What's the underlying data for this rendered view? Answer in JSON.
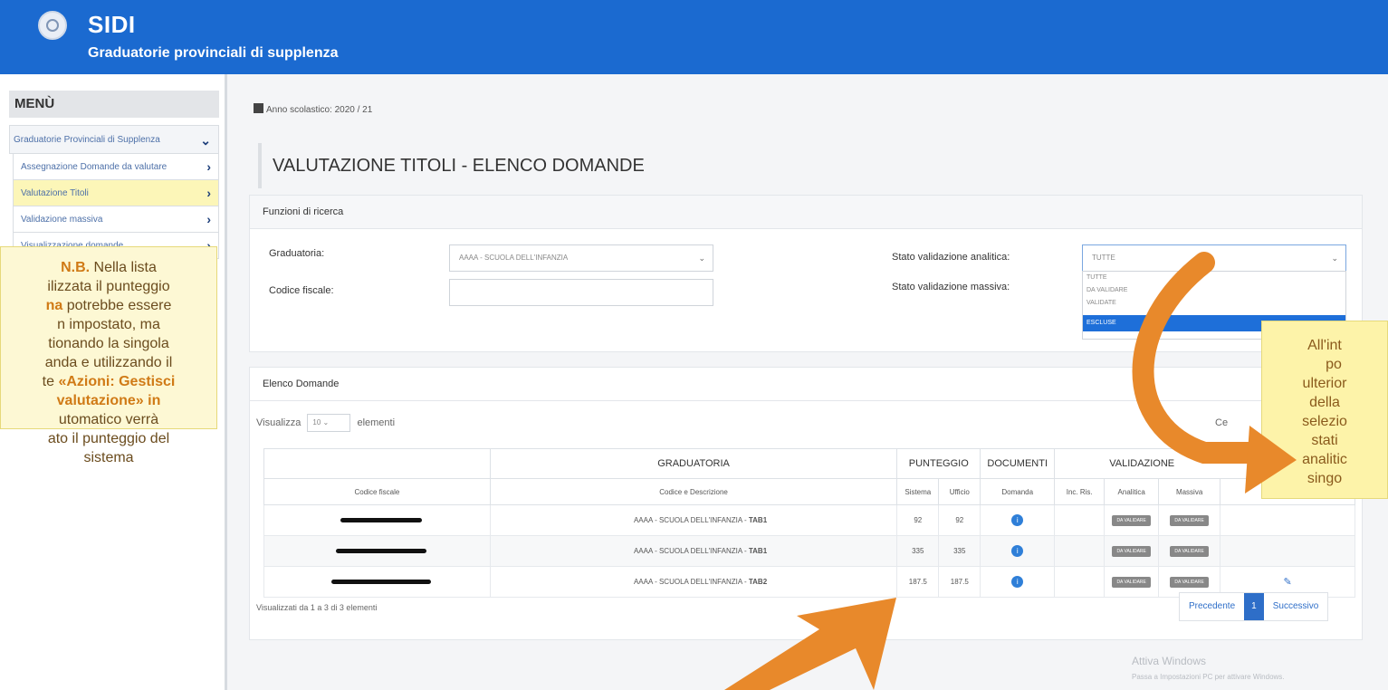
{
  "header": {
    "title": "SIDI",
    "subtitle": "Graduatorie provinciali di supplenza"
  },
  "sidebar": {
    "menu_title": "MENÙ",
    "items": [
      {
        "label": "Graduatorie Provinciali di Supplenza",
        "chevron": "v"
      },
      {
        "label": "Assegnazione Domande da valutare",
        "chevron": ">"
      },
      {
        "label": "Valutazione Titoli",
        "chevron": ">"
      },
      {
        "label": "Validazione massiva",
        "chevron": ">"
      },
      {
        "label": "Visualizzazione domande",
        "chevron": ">"
      }
    ]
  },
  "note_left": {
    "lines": [
      [
        "N.B.",
        " Nella lista"
      ],
      [
        "",
        "ilizzata il punteggio"
      ],
      [
        "na",
        " potrebbe essere"
      ],
      [
        "",
        "n impostato, ma"
      ],
      [
        "",
        "tionando la singola"
      ],
      [
        "",
        "anda e utilizzando il"
      ],
      [
        "te ",
        "«Azioni: Gestisci"
      ],
      [
        "",
        "valutazione»  in"
      ],
      [
        "",
        "utomatico verrà"
      ],
      [
        "",
        "ato il punteggio del"
      ],
      [
        "",
        "sistema"
      ]
    ]
  },
  "main": {
    "school_year": "Anno scolastico: 2020 / 21",
    "title": "VALUTAZIONE TITOLI - ELENCO DOMANDE",
    "search_panel": {
      "heading": "Funzioni di ricerca",
      "graduatoria_label": "Graduatoria:",
      "graduatoria_value": "AAAA - SCUOLA DELL'INFANZIA",
      "codice_label": "Codice fiscale:",
      "codice_value": "",
      "analitica_label": "Stato validazione analitica:",
      "analitica_value": "TUTTE",
      "massiva_label": "Stato validazione massiva:",
      "dropdown_options": [
        "TUTTE",
        "DA VALIDARE",
        "VALIDATE",
        "ESCLUSE"
      ]
    },
    "list_panel": {
      "heading": "Elenco Domande",
      "show_prefix": "Visualizza",
      "show_value": "10",
      "show_suffix": "elementi",
      "search_label": "Ce",
      "group_headers": [
        "GRADUATORIA",
        "PUNTEGGIO",
        "DOCUMENTI",
        "VALIDAZIONE"
      ],
      "columns": [
        "Codice fiscale",
        "Codice e Descrizione",
        "Sistema",
        "Ufficio",
        "Domanda",
        "Inc. Ris.",
        "Analitica",
        "Massiva"
      ],
      "rows": [
        {
          "desc": "AAAA - SCUOLA DELL'INFANZIA - ",
          "tab": "TAB1",
          "sistema": "92",
          "ufficio": "92",
          "analitica": "DA VALIDARE",
          "massiva": "DA VALIDARE"
        },
        {
          "desc": "AAAA - SCUOLA DELL'INFANZIA - ",
          "tab": "TAB1",
          "sistema": "335",
          "ufficio": "335",
          "analitica": "DA VALIDARE",
          "massiva": "DA VALIDARE"
        },
        {
          "desc": "AAAA - SCUOLA DELL'INFANZIA - ",
          "tab": "TAB2",
          "sistema": "187.5",
          "ufficio": "187.5",
          "analitica": "DA VALIDARE",
          "massiva": "DA VALIDARE"
        }
      ],
      "footer_text": "Visualizzati da 1 a 3 di 3 elementi",
      "pager": {
        "prev": "Precedente",
        "current": "1",
        "next": "Successivo"
      }
    }
  },
  "note_right": {
    "lines": [
      "All'int",
      "po",
      "ulterior",
      "della",
      "selezio",
      "stati",
      "analitic",
      "singo"
    ]
  },
  "watermark": {
    "title": "Attiva Windows",
    "subtitle": "Passa a Impostazioni PC per attivare Windows."
  },
  "colors": {
    "header_blue": "#1b6ad0",
    "highlight_yellow": "#fcf6b8",
    "annotation_orange": "#e8892b"
  }
}
